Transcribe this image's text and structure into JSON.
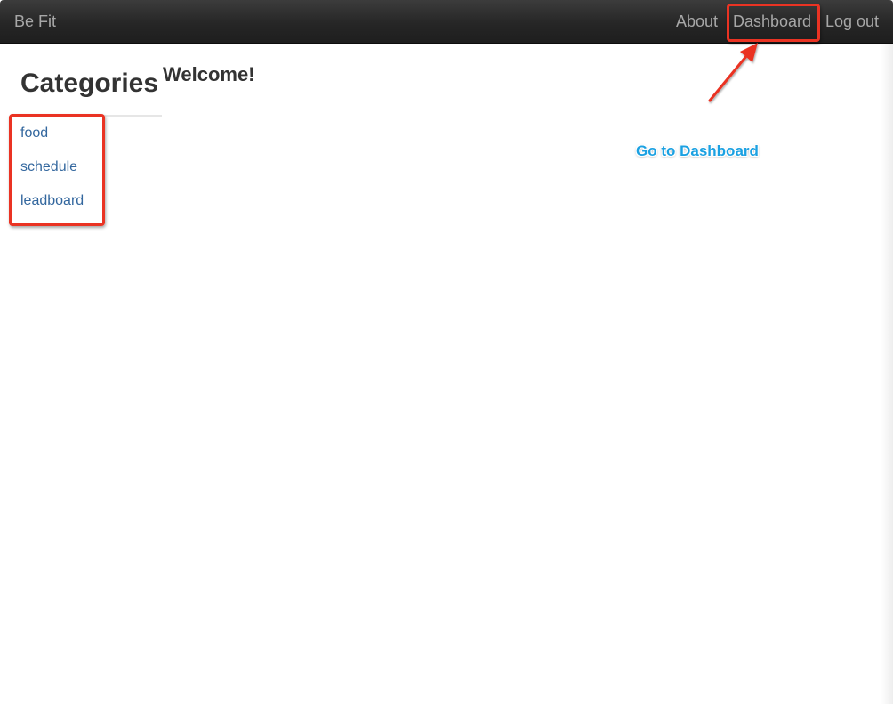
{
  "navbar": {
    "brand": "Be Fit",
    "links": [
      {
        "label": "About"
      },
      {
        "label": "Dashboard"
      },
      {
        "label": "Log out"
      }
    ]
  },
  "sidebar": {
    "heading": "Categories",
    "items": [
      {
        "label": "food"
      },
      {
        "label": "schedule"
      },
      {
        "label": "leadboard"
      }
    ]
  },
  "main": {
    "welcome": "Welcome!"
  },
  "annotations": {
    "callout_text": "Go to Dashboard",
    "callout_color": "#1ba1e2",
    "highlight_color": "#ea3323",
    "arrow_icon": "arrow-icon"
  },
  "colors": {
    "navbar_bg": "#222222",
    "nav_text": "#a7a7a7",
    "link": "#33679e",
    "heading": "#333333"
  }
}
